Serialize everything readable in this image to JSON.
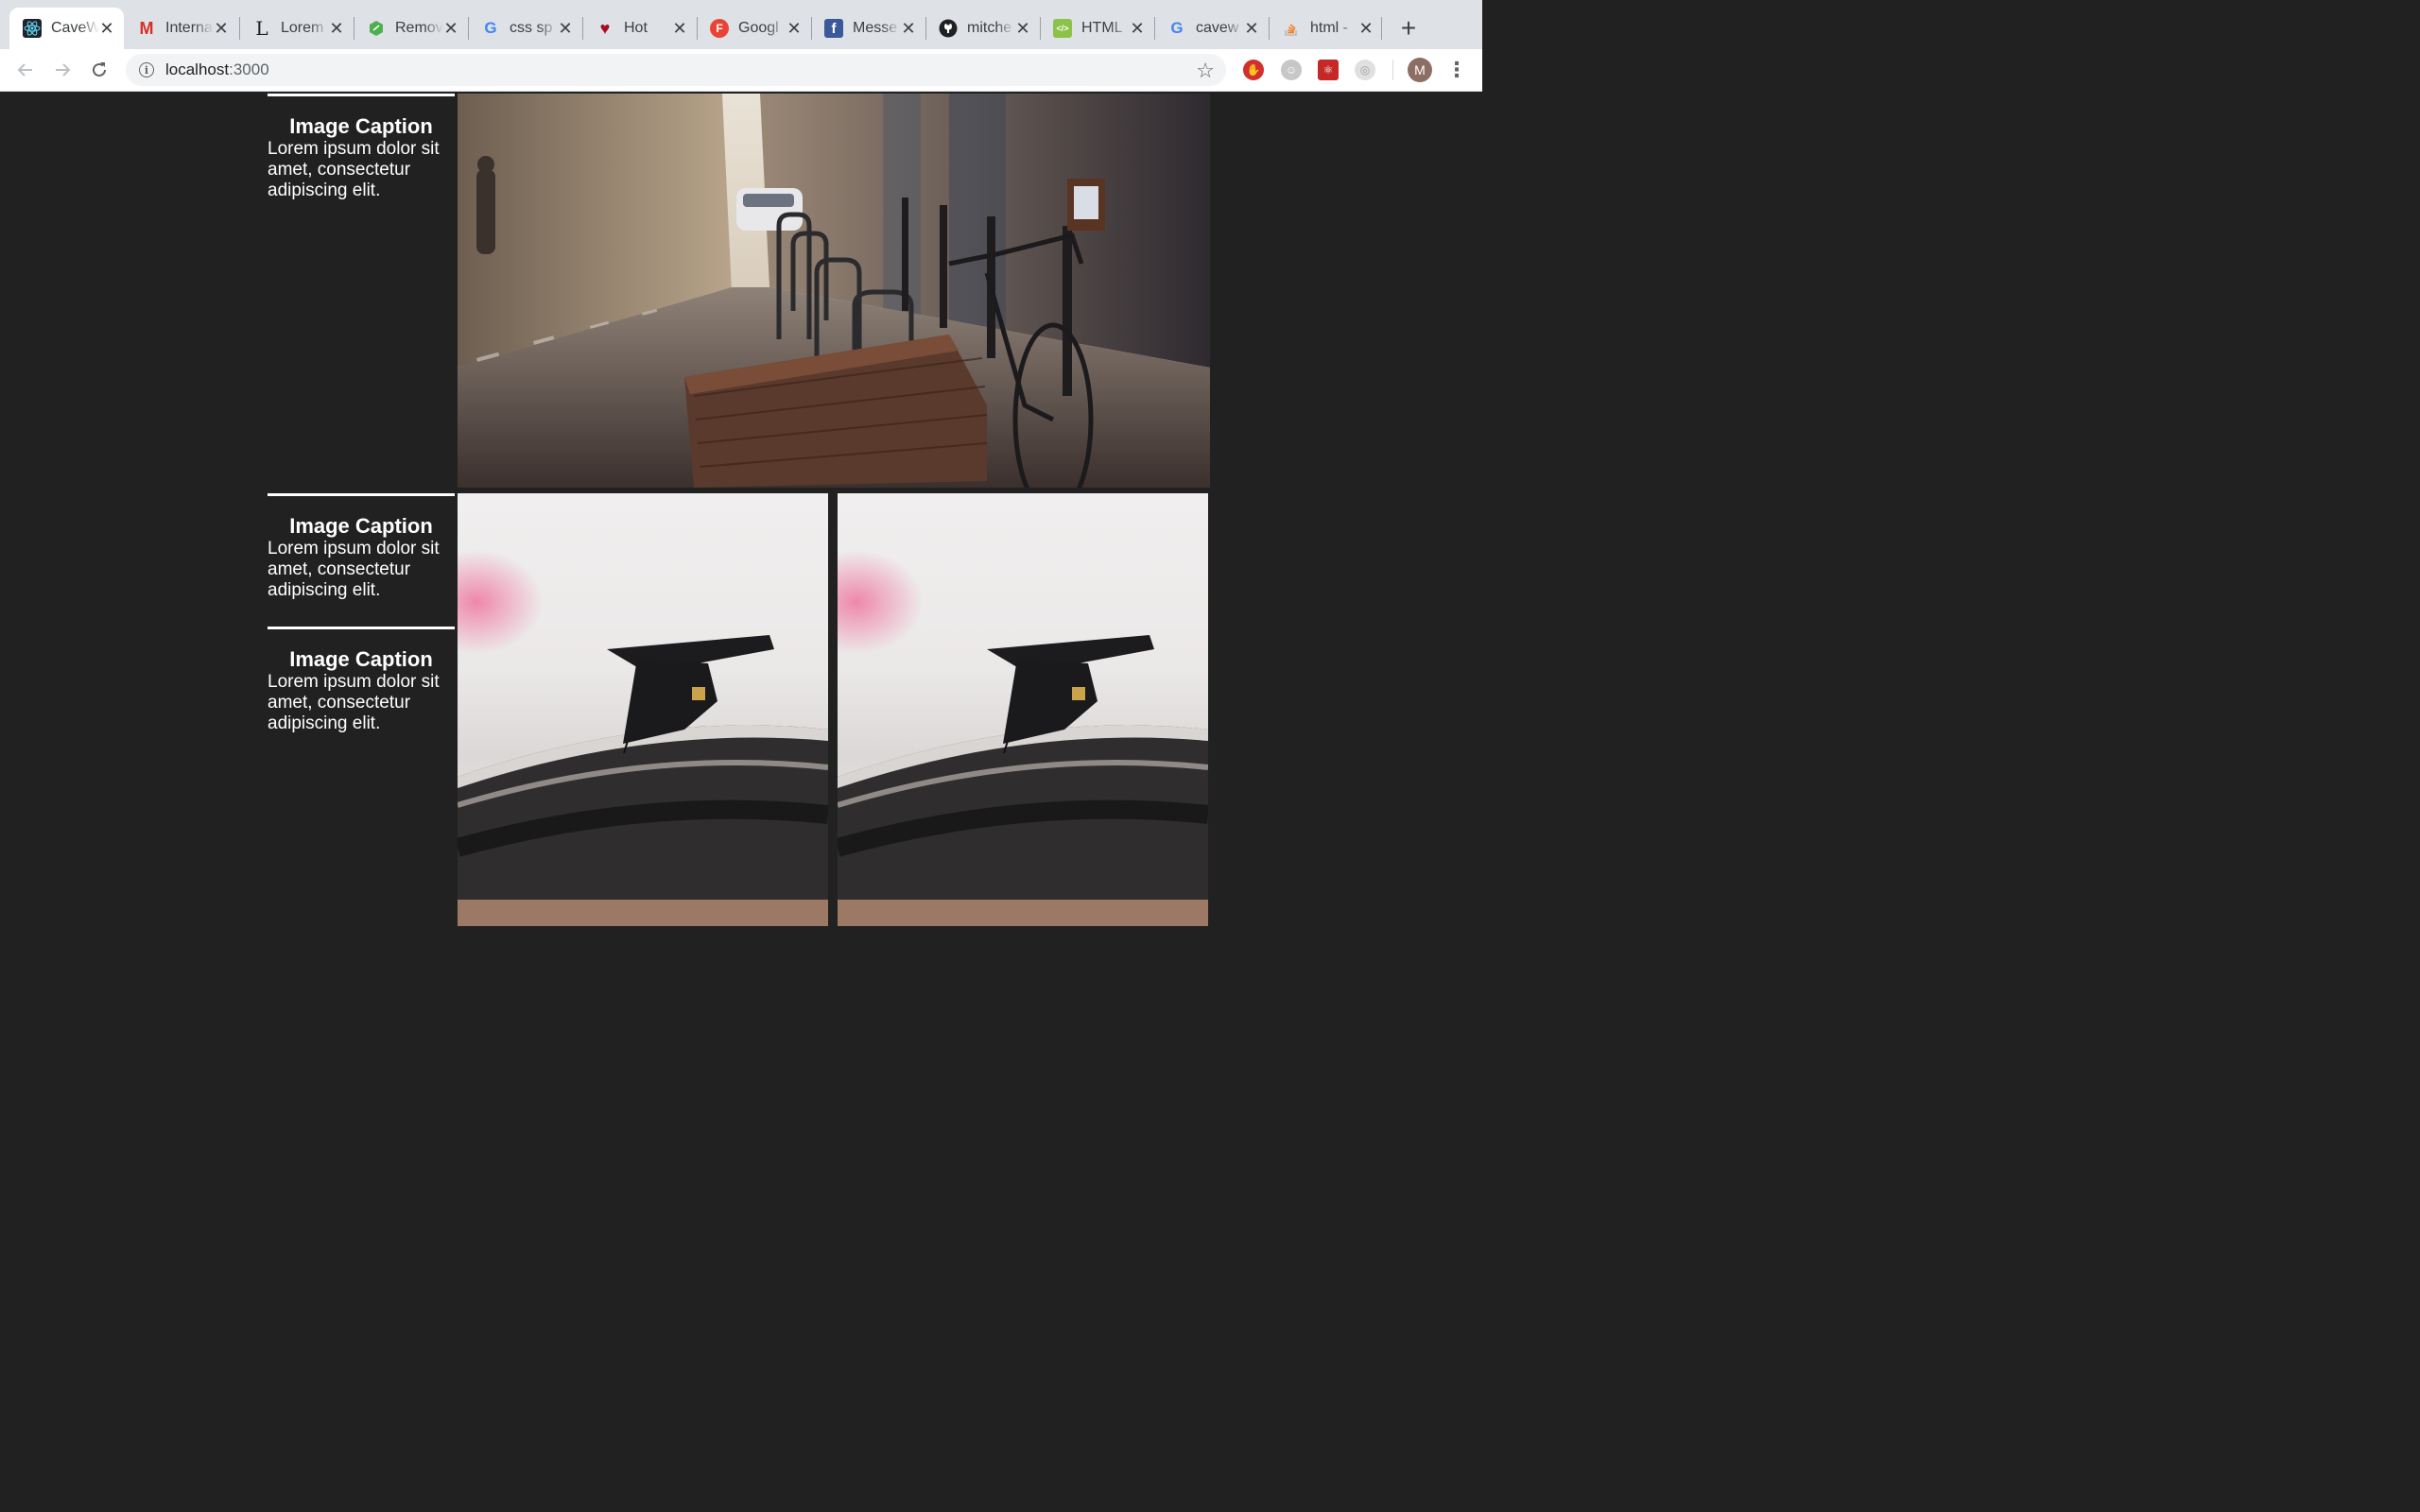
{
  "browser": {
    "tabs": [
      {
        "title": "CaveW",
        "favicon": "react-icon",
        "active": true
      },
      {
        "title": "Interna",
        "favicon": "gmail-icon"
      },
      {
        "title": "Lorem",
        "favicon": "lorem-l-icon"
      },
      {
        "title": "Remov",
        "favicon": "leaf-icon"
      },
      {
        "title": "css sp",
        "favicon": "google-icon"
      },
      {
        "title": "Hot",
        "favicon": "heart-icon"
      },
      {
        "title": "Googl",
        "favicon": "google-fonts-icon"
      },
      {
        "title": "Messe",
        "favicon": "facebook-icon"
      },
      {
        "title": "mitche",
        "favicon": "github-icon"
      },
      {
        "title": "HTML",
        "favicon": "html-icon"
      },
      {
        "title": "cavew",
        "favicon": "google-icon"
      },
      {
        "title": "html -",
        "favicon": "stackoverflow-icon"
      }
    ],
    "url_host": "localhost",
    "url_port": ":3000",
    "avatar_letter": "M"
  },
  "gallery": {
    "captions": [
      {
        "title": "Image Caption",
        "text": "Lorem ipsum dolor sit amet, consectetur adipiscing elit."
      },
      {
        "title": "Image Caption",
        "text": "Lorem ipsum dolor sit amet, consectetur adipiscing elit."
      },
      {
        "title": "Image Caption",
        "text": "Lorem ipsum dolor sit amet, consectetur adipiscing elit."
      }
    ]
  }
}
